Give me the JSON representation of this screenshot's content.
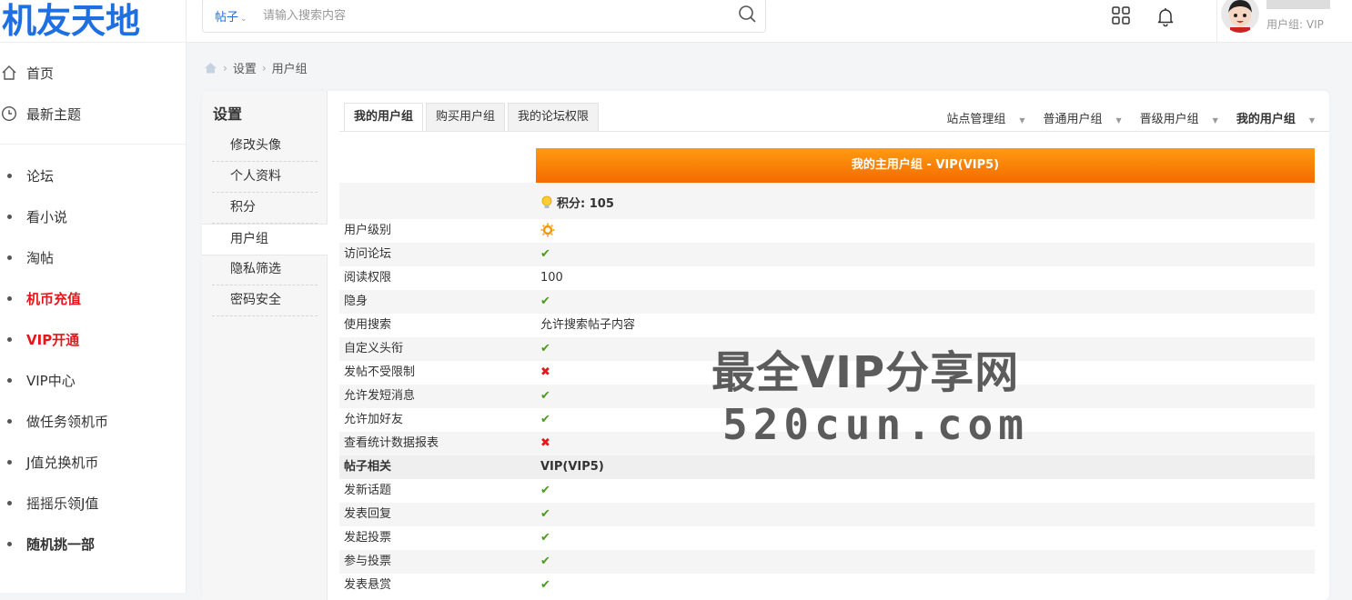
{
  "logo": "机友天地",
  "sidebar": {
    "top": [
      {
        "label": "首页",
        "icon": "home-icon"
      },
      {
        "label": "最新主题",
        "icon": "clock-icon"
      }
    ],
    "items": [
      {
        "label": "论坛",
        "style": "normal"
      },
      {
        "label": "看小说",
        "style": "normal"
      },
      {
        "label": "淘帖",
        "style": "normal"
      },
      {
        "label": "机币充值",
        "style": "red"
      },
      {
        "label": "VIP开通",
        "style": "red"
      },
      {
        "label": "VIP中心",
        "style": "normal"
      },
      {
        "label": "做任务领机币",
        "style": "normal"
      },
      {
        "label": "J值兑换机币",
        "style": "normal"
      },
      {
        "label": "摇摇乐领J值",
        "style": "normal"
      },
      {
        "label": "随机挑一部",
        "style": "bold"
      }
    ]
  },
  "header": {
    "search_scope": "帖子",
    "search_placeholder": "请输入搜索内容",
    "user_group": "用户组: VIP"
  },
  "breadcrumb": [
    "设置",
    "用户组"
  ],
  "settings": {
    "title": "设置",
    "items": [
      "修改头像",
      "个人资料",
      "积分",
      "用户组",
      "隐私筛选",
      "密码安全"
    ],
    "active": "用户组"
  },
  "tabs": [
    "我的用户组",
    "购买用户组",
    "我的论坛权限"
  ],
  "group_types": [
    "站点管理组",
    "普通用户组",
    "晋级用户组",
    "我的用户组"
  ],
  "main_group": "我的主用户组 - VIP(VIP5)",
  "points": "积分: 105",
  "permissions": [
    {
      "label": "用户级别",
      "value": "level-icons"
    },
    {
      "label": "访问论坛",
      "value": "check"
    },
    {
      "label": "阅读权限",
      "value": "100"
    },
    {
      "label": "隐身",
      "value": "check"
    },
    {
      "label": "使用搜索",
      "value": "允许搜索帖子内容"
    },
    {
      "label": "自定义头衔",
      "value": "check"
    },
    {
      "label": "发帖不受限制",
      "value": "cross"
    },
    {
      "label": "允许发短消息",
      "value": "check"
    },
    {
      "label": "允许加好友",
      "value": "check"
    },
    {
      "label": "查看统计数据报表",
      "value": "cross"
    }
  ],
  "post_section": {
    "title": "帖子相关",
    "group": "VIP(VIP5)",
    "items": [
      {
        "label": "发新话题",
        "value": "check"
      },
      {
        "label": "发表回复",
        "value": "check"
      },
      {
        "label": "发起投票",
        "value": "check"
      },
      {
        "label": "参与投票",
        "value": "check"
      },
      {
        "label": "发表悬赏",
        "value": "check"
      }
    ]
  },
  "watermark": {
    "line1": "最全VIP分享网",
    "line2": "520cun.com"
  },
  "colors": {
    "accent": "#1e6fe0",
    "banner": "#f57a06",
    "check": "#4c9a1e",
    "cross": "#e5161c",
    "red_nav": "#e5161c"
  }
}
